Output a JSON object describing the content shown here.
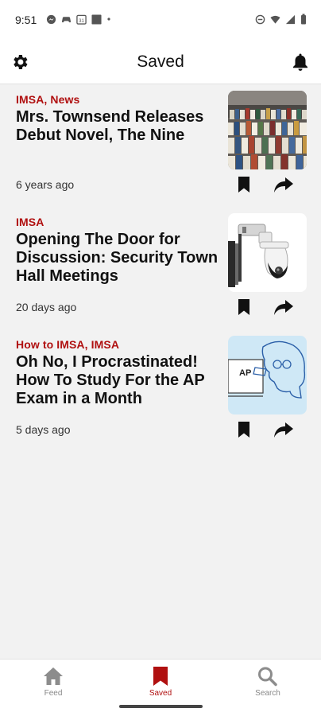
{
  "status_bar": {
    "time": "9:51",
    "left_icons": [
      "messenger-icon",
      "game-controller-icon",
      "calendar-31-icon",
      "app-square-icon",
      "dot-icon"
    ],
    "right_icons": [
      "do-not-disturb-icon",
      "wifi-icon",
      "signal-icon",
      "battery-icon"
    ]
  },
  "header": {
    "title": "Saved",
    "left_icon": "gear-icon",
    "right_icon": "bell-icon"
  },
  "colors": {
    "accent": "#b01010",
    "background": "#f2f2f2",
    "text": "#111111"
  },
  "articles": [
    {
      "tags": "IMSA, News",
      "title": "Mrs. Townsend Releases Debut Novel, The Nine",
      "time": "6 years ago",
      "thumbnail": "bookstore-books-photo"
    },
    {
      "tags": "IMSA",
      "title": "Opening The Door for Discussion: Security Town Hall Meetings",
      "time": "20 days ago",
      "thumbnail": "security-camera-photo"
    },
    {
      "tags": "How to IMSA, IMSA",
      "title": "Oh No, I Procrastinated! How To Study For the AP Exam in a Month",
      "time": "5 days ago",
      "thumbnail": "ap-exam-illustration",
      "thumbnail_text": "AP"
    }
  ],
  "bottom_nav": {
    "items": [
      {
        "label": "Feed",
        "icon": "home-icon",
        "active": false
      },
      {
        "label": "Saved",
        "icon": "bookmark-icon",
        "active": true
      },
      {
        "label": "Search",
        "icon": "search-icon",
        "active": false
      }
    ]
  }
}
